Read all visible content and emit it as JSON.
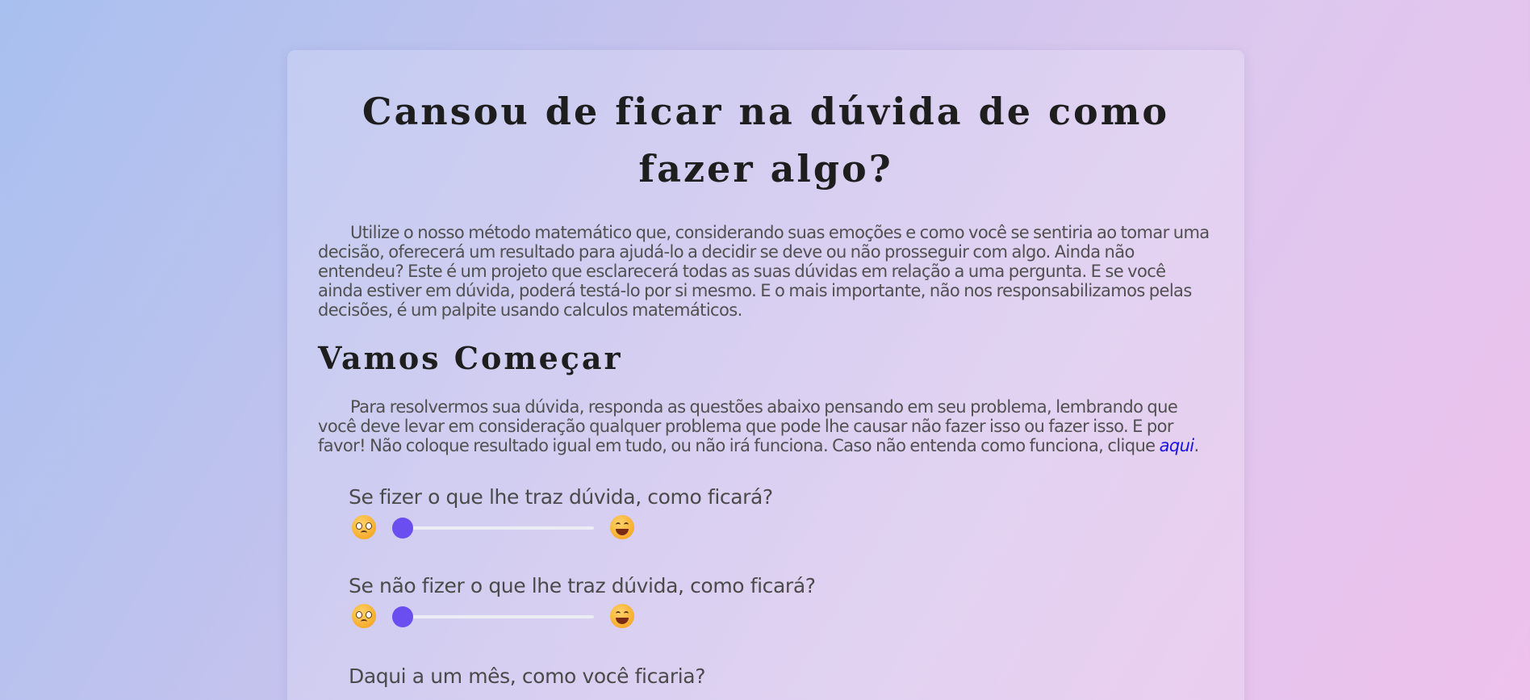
{
  "hero": {
    "title": "Cansou de ficar na dúvida de como fazer algo?",
    "intro": "Utilize o nosso método matemático que, considerando suas emoções e como você se sentiria ao tomar uma decisão, oferecerá um resultado para ajudá-lo a decidir se deve ou não prosseguir com algo. Ainda não entendeu? Este é um projeto que esclarecerá todas as suas dúvidas em relação a uma pergunta. E se você ainda estiver em dúvida, poderá testá-lo por si mesmo. E o mais importante, não nos responsabilizamos pelas decisões, é um palpite usando calculos matemáticos."
  },
  "start": {
    "title": "Vamos Começar",
    "instructions": "Para resolvermos sua dúvida, responda as questões abaixo pensando em seu problema, lembrando que você deve levar em consideração qualquer problema que pode lhe causar não fazer isso ou fazer isso. E por favor! Não coloque resultado igual em tudo, ou não irá funciona. Caso não entenda como funciona, clique ",
    "link_text": "aqui",
    "instructions_end": "."
  },
  "questions": [
    {
      "label": "Se fizer o que lhe traz dúvida, como ficará?",
      "left_icon": "crying-face-icon",
      "right_icon": "grinning-face-icon",
      "value": 0
    },
    {
      "label": "Se não fizer o que lhe traz dúvida, como ficará?",
      "left_icon": "crying-face-icon",
      "right_icon": "grinning-face-icon",
      "value": 0
    },
    {
      "label": "Daqui a um mês, como você ficaria?"
    }
  ],
  "colors": {
    "slider_thumb": "#6a4ef0",
    "slider_track": "#ececf4",
    "link": "#1a14e0",
    "heading": "#1e1e1e",
    "body_text": "#505050"
  }
}
